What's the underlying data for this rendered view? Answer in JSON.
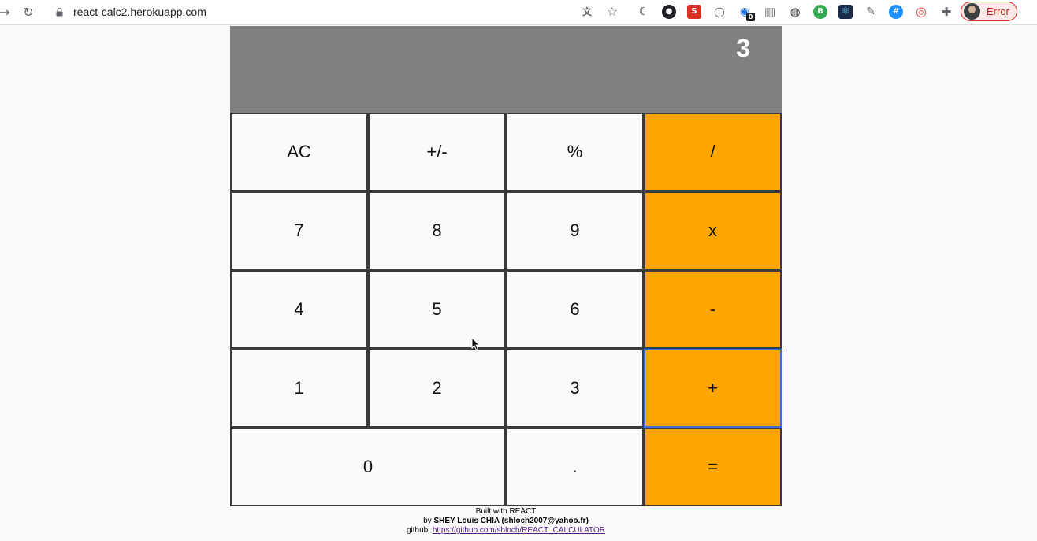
{
  "browser": {
    "url": "react-calc2.herokuapp.com",
    "profile_status": "Error",
    "extension_badge": "0",
    "extensions": [
      {
        "name": "translate-icon",
        "glyph": "文",
        "color": "#5f6368"
      },
      {
        "name": "bookmark-star-icon",
        "glyph": "☆",
        "color": "#5f6368"
      },
      {
        "name": "moon-ext-icon",
        "glyph": "☾",
        "color": "#202124"
      },
      {
        "name": "spy-ext-icon",
        "glyph": "●",
        "color": "#202124"
      },
      {
        "name": "s-ext-icon",
        "glyph": "S",
        "color": "#d93025"
      },
      {
        "name": "circle-ext-icon",
        "glyph": "○",
        "color": "#5f6368"
      },
      {
        "name": "ghost-ext-icon",
        "glyph": "◉",
        "color": "#1a73e8"
      },
      {
        "name": "trash-ext-icon",
        "glyph": "▥",
        "color": "#5f6368"
      },
      {
        "name": "lightbulb-ext-icon",
        "glyph": "◍",
        "color": "#3c4043"
      },
      {
        "name": "b-ext-icon",
        "glyph": "B",
        "color": "#34a853"
      },
      {
        "name": "react-ext-icon",
        "glyph": "⚛",
        "color": "#1a2b4c"
      },
      {
        "name": "eyedropper-ext-icon",
        "glyph": "✎",
        "color": "#5f6368"
      },
      {
        "name": "hash-ext-icon",
        "glyph": "#",
        "color": "#1e90ff"
      },
      {
        "name": "spiral-ext-icon",
        "glyph": "◎",
        "color": "#e8453c"
      },
      {
        "name": "puzzle-icon",
        "glyph": "✚",
        "color": "#5f6368"
      }
    ]
  },
  "calculator": {
    "display": "3",
    "accent_color": "#ffa500",
    "display_color": "#808080",
    "keys": {
      "ac": "AC",
      "sign": "+/-",
      "percent": "%",
      "divide": "/",
      "seven": "7",
      "eight": "8",
      "nine": "9",
      "multiply": "x",
      "four": "4",
      "five": "5",
      "six": "6",
      "subtract": "-",
      "one": "1",
      "two": "2",
      "three": "3",
      "add": "+",
      "zero": "0",
      "decimal": ".",
      "equals": "="
    }
  },
  "footer": {
    "built_with": "Built with REACT",
    "by_prefix": "by ",
    "author": "SHEY Louis CHIA (shloch2007@yahoo.fr)",
    "github_prefix": "github: ",
    "github_link": "https://github.com/shloch/REACT_CALCULATOR"
  }
}
